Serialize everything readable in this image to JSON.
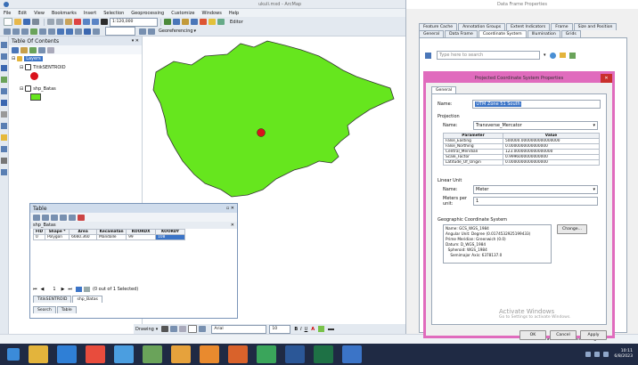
{
  "app": {
    "title": "ukuli.mxd - ArcMap",
    "menu": [
      "File",
      "Edit",
      "View",
      "Bookmarks",
      "Insert",
      "Selection",
      "Geoprocessing",
      "Customize",
      "Windows",
      "Help"
    ],
    "scale": "1:120,000",
    "georef_label": "Georeferencing",
    "editor_label": "Editor"
  },
  "toc": {
    "title": "Table Of Contents",
    "layers_label": "Layers",
    "layer1": "TitikSENTROID",
    "layer2": "shp_Batas"
  },
  "table_window": {
    "title": "Table",
    "layer_name": "shp_Batas",
    "columns": [
      "FID",
      "Shape *",
      "Area",
      "Kecamatan",
      "KOORDX",
      "KOORDY"
    ],
    "rows": [
      [
        "0",
        "Polygon",
        "6660.360",
        "Mandalle",
        "99",
        "108"
      ]
    ],
    "record_nav": "1",
    "selected_status": "(0 out of 1 Selected)",
    "tab1": "TitikSENTROID",
    "tab2": "shp_Batas",
    "bottom1": "Search",
    "bottom2": "Table"
  },
  "bottom_toolbar": {
    "drawing_label": "Drawing",
    "font": "Arial",
    "font_size": "10"
  },
  "status_bar": {
    "coords": "42.990 26.15 Decimal Degrees"
  },
  "data_frame_props": {
    "title": "Data Frame Properties",
    "tabs_row1": [
      "Feature Cache",
      "Annotation Groups",
      "Extent Indicators",
      "Frame",
      "Size and Position"
    ],
    "tabs_row2": [
      "General",
      "Data Frame",
      "Coordinate System",
      "Illumination",
      "Grids"
    ],
    "active_tab": "Coordinate System",
    "search_placeholder": "Type here to search"
  },
  "projected_dialog": {
    "title": "Projected Coordinate System Properties",
    "tab_general": "General",
    "name_label": "Name:",
    "name_value": "UTM Zone 51 South",
    "projection_heading": "Projection",
    "projection_name_label": "Name:",
    "projection_value": "Transverse_Mercator",
    "param_col": "Parameter",
    "value_col": "Value",
    "params": [
      [
        "False_Easting",
        "500000.0000000000000000"
      ],
      [
        "False_Northing",
        "0.0000000000000000"
      ],
      [
        "Central_Meridian",
        "123.0000000000000000"
      ],
      [
        "Scale_Factor",
        "0.9996000000000000"
      ],
      [
        "Latitude_Of_Origin",
        "0.0000000000000000"
      ]
    ],
    "linear_unit_heading": "Linear Unit",
    "unit_name_label": "Name:",
    "unit_value": "Meter",
    "meters_label": "Meters per unit:",
    "meters_value": "1",
    "gcs_heading": "Geographic Coordinate System",
    "gcs_lines": [
      "Name: GCS_WGS_1984",
      "Angular Unit: Degree (0.0174532925199433)",
      "Prime Meridian: Greenwich (0.0)",
      "Datum: D_WGS_1984",
      "  Spheroid: WGS_1984",
      "    Semimajor Axis: 6378137.0"
    ],
    "change_button": "Change...",
    "ok": "OK",
    "cancel": "Cancel",
    "apply": "Apply"
  },
  "watermark": {
    "line1": "Activate Windows",
    "line2": "Go to Settings to activate Windows."
  },
  "taskbar": {
    "time": "10:11",
    "date": "6/8/2023"
  },
  "colors": {
    "polygon_fill": "#66e61e",
    "point": "#d9121c",
    "dialog_border": "#e06bbd",
    "taskbar": "#1f2a44"
  }
}
